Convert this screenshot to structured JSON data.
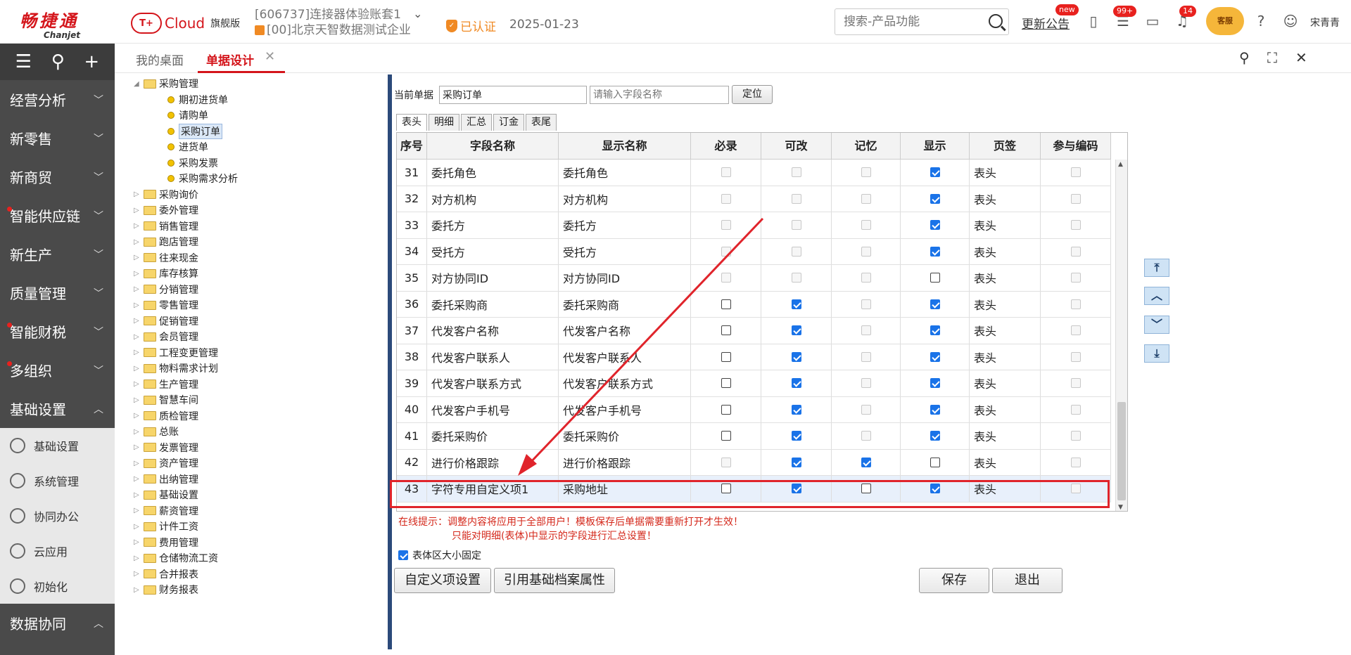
{
  "header": {
    "brand_cn": "畅捷通",
    "brand_en": "Chanjet",
    "cloud_icon": "T+",
    "cloud_text": "Cloud",
    "edition": "旗舰版",
    "account_line1": "[606737]连接器体验账套1",
    "account_line2": "[00]北京天智数据测试企业",
    "certified": "已认证",
    "date": "2025-01-23",
    "search_placeholder": "搜索-产品功能",
    "notice": "更新公告",
    "notice_badge": "new",
    "task_badge": "99+",
    "bell_badge": "14",
    "kefu": "客服",
    "username": "宋青青"
  },
  "leftnav": {
    "items": [
      {
        "label": "经营分析",
        "dot": false
      },
      {
        "label": "新零售",
        "dot": false
      },
      {
        "label": "新商贸",
        "dot": false
      },
      {
        "label": "智能供应链",
        "dot": true
      },
      {
        "label": "新生产",
        "dot": false
      },
      {
        "label": "质量管理",
        "dot": false
      },
      {
        "label": "智能财税",
        "dot": true
      },
      {
        "label": "多组织",
        "dot": true
      },
      {
        "label": "基础设置",
        "dot": false
      }
    ],
    "subitems": [
      "基础设置",
      "系统管理",
      "协同办公",
      "云应用",
      "初始化"
    ],
    "bottom_item": "数据协同"
  },
  "tabs": {
    "desktop": "我的桌面",
    "design": "单据设计"
  },
  "tree": {
    "root": "采购管理",
    "children": [
      "期初进货单",
      "请购单",
      "采购订单",
      "进货单",
      "采购发票",
      "采购需求分析"
    ],
    "selected": "采购订单",
    "folders": [
      "采购询价",
      "委外管理",
      "销售管理",
      "跑店管理",
      "往来现金",
      "库存核算",
      "分销管理",
      "零售管理",
      "促销管理",
      "会员管理",
      "工程变更管理",
      "物料需求计划",
      "生产管理",
      "智慧车间",
      "质检管理",
      "总账",
      "发票管理",
      "资产管理",
      "出纳管理",
      "基础设置",
      "薪资管理",
      "计件工资",
      "费用管理",
      "仓储物流工资",
      "合并报表",
      "财务报表"
    ]
  },
  "designer": {
    "current_label": "当前单据",
    "current_value": "采购订单",
    "field_placeholder": "请输入字段名称",
    "locate": "定位",
    "subtabs": [
      "表头",
      "明细",
      "汇总",
      "订金",
      "表尾"
    ],
    "columns": [
      "序号",
      "字段名称",
      "显示名称",
      "必录",
      "可改",
      "记忆",
      "显示",
      "页签",
      "参与编码"
    ],
    "rows": [
      {
        "no": "31",
        "field": "委托角色",
        "display": "委托角色",
        "req": "dis",
        "edit": "dis",
        "mem": "dis",
        "show": "on",
        "tab": "表头",
        "code": "dis"
      },
      {
        "no": "32",
        "field": "对方机构",
        "display": "对方机构",
        "req": "dis",
        "edit": "dis",
        "mem": "dis",
        "show": "on",
        "tab": "表头",
        "code": "dis"
      },
      {
        "no": "33",
        "field": "委托方",
        "display": "委托方",
        "req": "dis",
        "edit": "dis",
        "mem": "dis",
        "show": "on",
        "tab": "表头",
        "code": "dis"
      },
      {
        "no": "34",
        "field": "受托方",
        "display": "受托方",
        "req": "dis",
        "edit": "dis",
        "mem": "dis",
        "show": "on",
        "tab": "表头",
        "code": "dis"
      },
      {
        "no": "35",
        "field": "对方协同ID",
        "display": "对方协同ID",
        "req": "dis",
        "edit": "dis",
        "mem": "dis",
        "show": "off",
        "tab": "表头",
        "code": "dis"
      },
      {
        "no": "36",
        "field": "委托采购商",
        "display": "委托采购商",
        "req": "off",
        "edit": "on",
        "mem": "dis",
        "show": "on",
        "tab": "表头",
        "code": "dis"
      },
      {
        "no": "37",
        "field": "代发客户名称",
        "display": "代发客户名称",
        "req": "off",
        "edit": "on",
        "mem": "dis",
        "show": "on",
        "tab": "表头",
        "code": "dis"
      },
      {
        "no": "38",
        "field": "代发客户联系人",
        "display": "代发客户联系人",
        "req": "off",
        "edit": "on",
        "mem": "dis",
        "show": "on",
        "tab": "表头",
        "code": "dis"
      },
      {
        "no": "39",
        "field": "代发客户联系方式",
        "display": "代发客户联系方式",
        "req": "off",
        "edit": "on",
        "mem": "dis",
        "show": "on",
        "tab": "表头",
        "code": "dis"
      },
      {
        "no": "40",
        "field": "代发客户手机号",
        "display": "代发客户手机号",
        "req": "off",
        "edit": "on",
        "mem": "dis",
        "show": "on",
        "tab": "表头",
        "code": "dis"
      },
      {
        "no": "41",
        "field": "委托采购价",
        "display": "委托采购价",
        "req": "off",
        "edit": "on",
        "mem": "dis",
        "show": "on",
        "tab": "表头",
        "code": "dis"
      },
      {
        "no": "42",
        "field": "进行价格跟踪",
        "display": "进行价格跟踪",
        "req": "dis",
        "edit": "on",
        "mem": "on",
        "show": "off",
        "tab": "表头",
        "code": "dis"
      },
      {
        "no": "43",
        "field": "字符专用自定义项1",
        "display": "采购地址",
        "req": "off",
        "edit": "on",
        "mem": "off",
        "show": "on",
        "tab": "表头",
        "code": "dis"
      }
    ],
    "tip_line1": "在线提示：调整内容将应用于全部用户！模板保存后单据需要重新打开才生效！",
    "tip_line2": "只能对明细(表体)中显示的字段进行汇总设置！",
    "fixed_label": "表体区大小固定",
    "btn_custom": "自定义项设置",
    "btn_ref": "引用基础档案属性",
    "btn_save": "保存",
    "btn_exit": "退出",
    "move_buttons": [
      "⤒",
      "︿",
      "﹀",
      "⤓"
    ]
  },
  "colors": {
    "brand_red": "#d4151b",
    "highlight_box": "#e0242b",
    "checkbox_blue": "#1a73e8"
  }
}
